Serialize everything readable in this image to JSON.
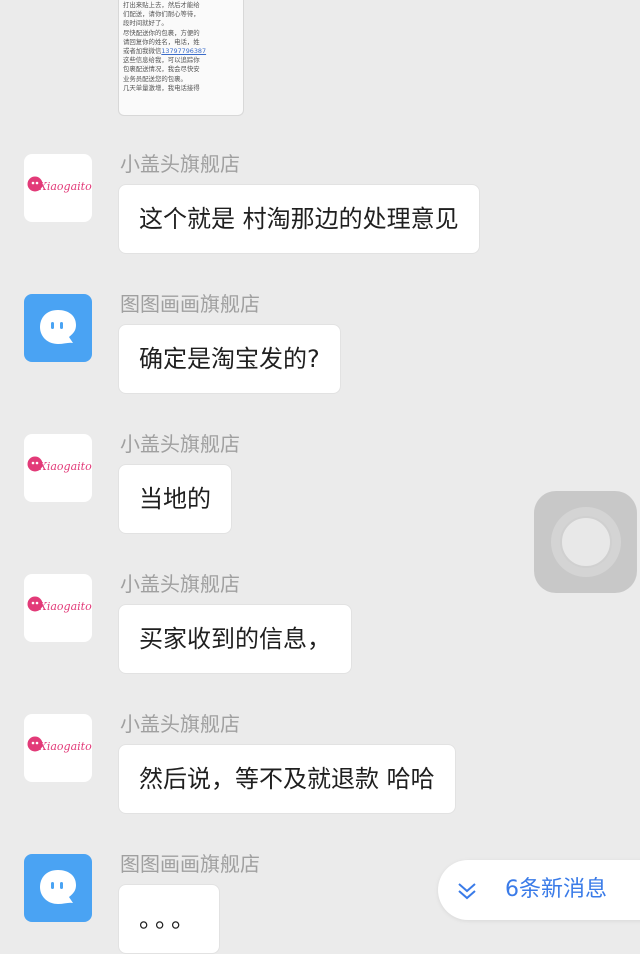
{
  "image_snippet": {
    "lines": [
      "打出来贴上去，然后才能给",
      "们配送，请你们耐心等待，",
      "段时间就好了。",
      "尽快配送你的包裹，方便的",
      "请回复你的姓名，电话，姓",
      "或者加我微信",
      "这些信息给我，可以追踪你",
      "包裹配送情况，我会尽快安",
      "业务员配送您的包裹。",
      "几天单量激增，我电话接得"
    ],
    "phone": "13797796387"
  },
  "messages": [
    {
      "sender": "小盖头旗舰店",
      "text": "这个就是 村淘那边的处理意见",
      "avatar": "xiaogaitou-logo"
    },
    {
      "sender": "图图画画旗舰店",
      "text": "确定是淘宝发的?",
      "avatar": "blue-chat-avatar"
    },
    {
      "sender": "小盖头旗舰店",
      "text": "当地的",
      "avatar": "xiaogaitou-logo"
    },
    {
      "sender": "小盖头旗舰店",
      "text": "买家收到的信息，",
      "avatar": "xiaogaitou-logo"
    },
    {
      "sender": "小盖头旗舰店",
      "text": "然后说，等不及就退款  哈哈",
      "avatar": "xiaogaitou-logo"
    },
    {
      "sender": "图图画画旗舰店",
      "text": "。。。",
      "avatar": "blue-chat-avatar"
    }
  ],
  "logo_text": "Xiaogaitou",
  "new_messages": {
    "label": "6条新消息",
    "icon": "chevron-down-icon"
  },
  "colors": {
    "accent": "#3a7be8",
    "logo_pink": "#e23a78",
    "avatar_blue": "#4aa3f3"
  }
}
